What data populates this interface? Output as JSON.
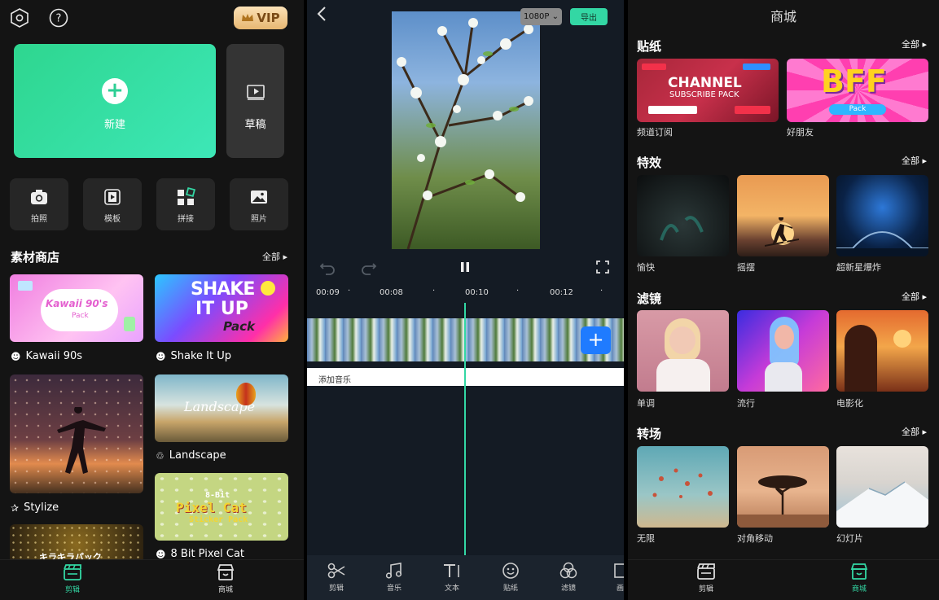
{
  "left": {
    "vip_label": "VIP",
    "new_label": "新建",
    "draft_label": "草稿",
    "tools": [
      "拍照",
      "模板",
      "拼接",
      "照片"
    ],
    "store_title": "素材商店",
    "store_all": "全部",
    "items": {
      "kawaii": {
        "label": "Kawaii 90s",
        "thumb_line1": "Kawaii 90's",
        "thumb_line2": "Pack"
      },
      "shake": {
        "label": "Shake It Up",
        "thumb_line1": "SHAKE",
        "thumb_line2": "IT UP",
        "thumb_line3": "Pack"
      },
      "stylize": {
        "label": "Stylize"
      },
      "landscape": {
        "label": "Landscape",
        "thumb_text": "Landscape"
      },
      "pixel": {
        "label": "8 Bit Pixel Cat",
        "thumb_line1": "8-Bit",
        "thumb_line2": "Pixel Cat",
        "thumb_line3": "Sticker Pack"
      },
      "kira": {
        "thumb_text": "キラキラパック"
      }
    },
    "nav": {
      "edit": "剪辑",
      "store": "商城"
    }
  },
  "editor": {
    "resolution": "1080P",
    "export_label": "导出",
    "timecodes": [
      "00:09",
      "00:08",
      "00:10",
      "00:12"
    ],
    "add_music": "添加音乐",
    "toolbar": [
      "剪辑",
      "音乐",
      "文本",
      "贴纸",
      "滤镜",
      "画"
    ]
  },
  "store": {
    "title": "商城",
    "all_label": "全部",
    "sections": [
      {
        "title": "贴纸",
        "items": [
          "频道订阅",
          "好朋友"
        ]
      },
      {
        "title": "特效",
        "items": [
          "愉快",
          "摇摆",
          "超新星爆炸"
        ]
      },
      {
        "title": "滤镜",
        "items": [
          "单调",
          "流行",
          "电影化"
        ]
      },
      {
        "title": "转场",
        "items": [
          "无限",
          "对角移动",
          "幻灯片"
        ]
      }
    ],
    "channel_thumb": {
      "line1": "CHANNEL",
      "line2": "SUBSCRIBE PACK"
    },
    "bff_thumb": {
      "line1": "BFF",
      "line2": "Pack"
    },
    "nav": {
      "edit": "剪辑",
      "store": "商城"
    }
  },
  "colors": {
    "accent": "#33d7a4",
    "vip_gold": "#e7b772",
    "add_clip_blue": "#1f7bff",
    "playhead": "#33d7a4"
  }
}
